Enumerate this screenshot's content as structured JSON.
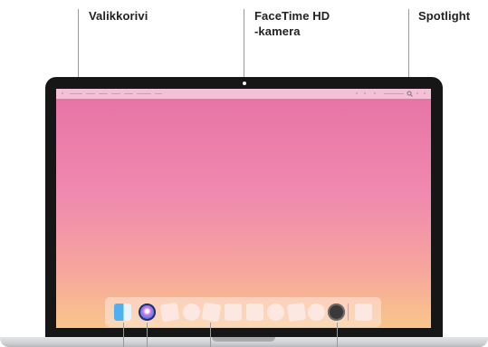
{
  "callouts": {
    "menubar": "Valikkorivi",
    "camera_line1": "FaceTime HD",
    "camera_line2": "-kamera",
    "spotlight": "Spotlight"
  },
  "colors": {
    "bezel": "#161616",
    "wallpaper_top": "#e673a6",
    "wallpaper_bottom": "#f8c68a",
    "leader_line": "#9a9a9a"
  },
  "dock": {
    "items": [
      "finder-icon",
      "siri-icon",
      "app-placeholder",
      "app-placeholder",
      "app-placeholder",
      "app-placeholder",
      "app-placeholder",
      "app-placeholder",
      "app-placeholder",
      "app-placeholder",
      "system-preferences-icon",
      "trash-placeholder"
    ]
  }
}
